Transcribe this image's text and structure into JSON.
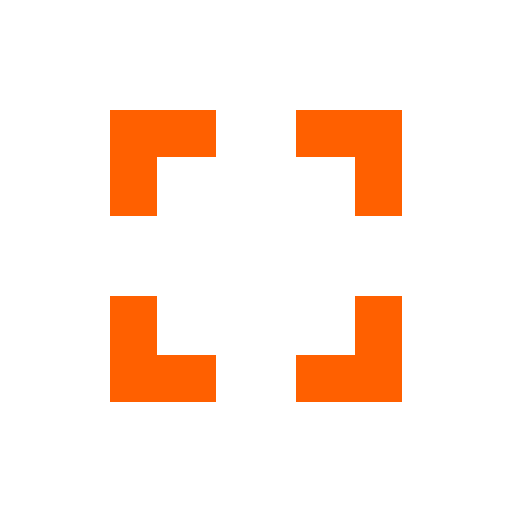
{
  "icon": {
    "name": "fullscreen-icon",
    "color": "#ff6000",
    "background": "#ffffff"
  }
}
